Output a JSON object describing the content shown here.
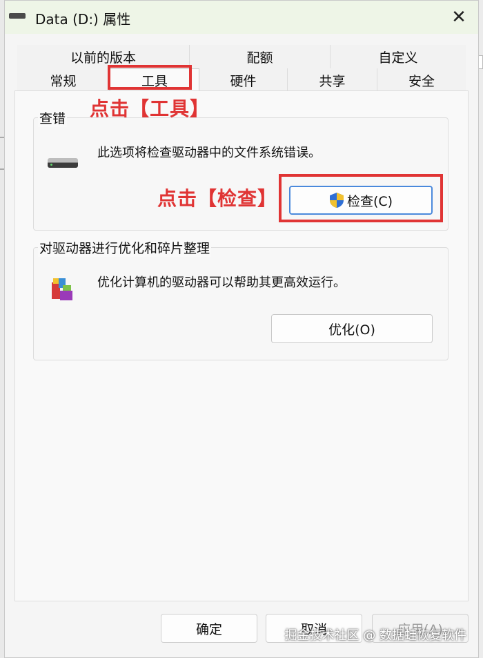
{
  "window": {
    "title": "Data (D:) 属性"
  },
  "tabs_row1": [
    "以前的版本",
    "配额",
    "自定义"
  ],
  "tabs_row2": [
    "常规",
    "工具",
    "硬件",
    "共享",
    "安全"
  ],
  "error_check": {
    "title": "查错",
    "description": "此选项将检查驱动器中的文件系统错误。",
    "button_label": "检查(C)"
  },
  "optimize": {
    "title": "对驱动器进行优化和碎片整理",
    "description": "优化计算机的驱动器可以帮助其更高效运行。",
    "button_label": "优化(O)"
  },
  "annotations": {
    "tools_hint": "点击【工具】",
    "check_hint": "点击【检查】"
  },
  "footer": {
    "ok_label": "确定",
    "cancel_label": "取消",
    "apply_label": "应用(A)"
  },
  "watermark": "掘金技术社区 @ 数据蛙恢复软件",
  "colors": {
    "annotation": "#e03434",
    "titlebar": "#eef5e7",
    "shield_blue": "#2f6fd6",
    "shield_yellow": "#f2c12e"
  }
}
